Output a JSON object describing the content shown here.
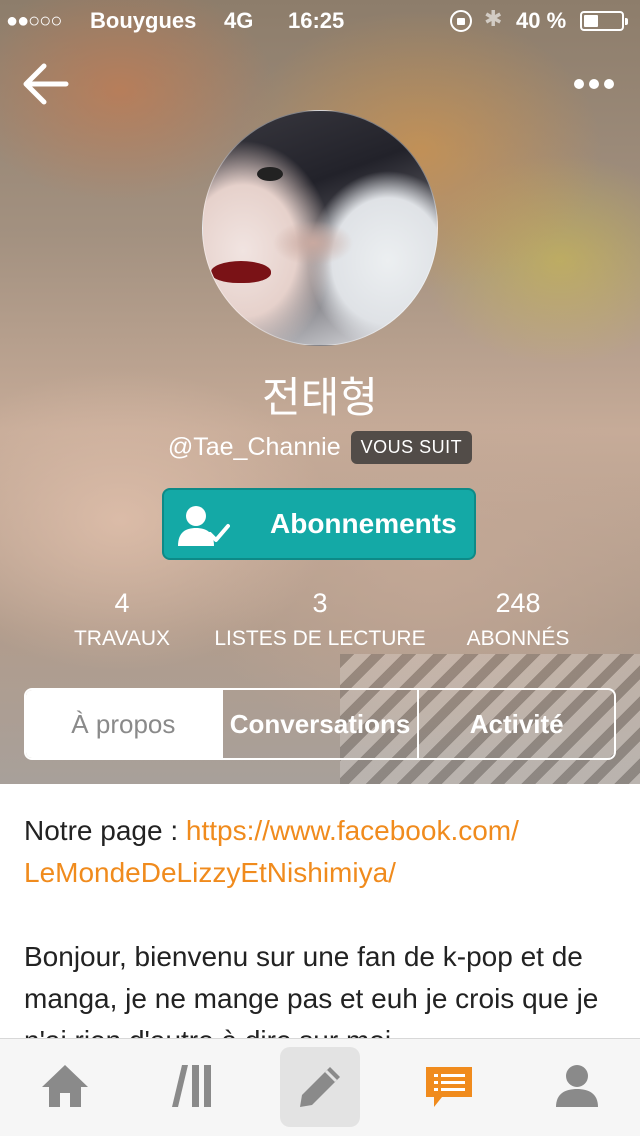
{
  "status_bar": {
    "signal": "●●○○○",
    "carrier": "Bouygues",
    "network": "4G",
    "time": "16:25",
    "bluetooth": "✱",
    "battery_pct": "40 %",
    "battery_level": 0.4
  },
  "profile": {
    "display_name": "전태형",
    "handle": "@Tae_Channie",
    "follows_you_badge": "VOUS SUIT",
    "follow_button_label": "Abonnements"
  },
  "stats": [
    {
      "value": "4",
      "label": "TRAVAUX"
    },
    {
      "value": "3",
      "label": "LISTES DE LECTURE"
    },
    {
      "value": "248",
      "label": "ABONNÉS"
    }
  ],
  "tabs": [
    {
      "label": "À propos",
      "active": true
    },
    {
      "label": "Conversations",
      "active": false
    },
    {
      "label": "Activité",
      "active": false
    }
  ],
  "about": {
    "page_prefix": "Notre page : ",
    "page_link": "https://www.facebook.com/ LeMondeDeLizzyEtNishimiya/",
    "bio": "Bonjour, bienvenu sur une fan de k-pop et de manga, je ne mange pas et euh je crois que je n'ai rien d'autre à dire sur moi."
  },
  "tab_bar": {
    "items": [
      {
        "icon": "home-icon"
      },
      {
        "icon": "library-icon"
      },
      {
        "icon": "write-icon"
      },
      {
        "icon": "messages-icon"
      },
      {
        "icon": "profile-icon"
      }
    ]
  },
  "colors": {
    "accent_teal": "#14a9a6",
    "link_orange": "#f08b1d",
    "active_tab_orange": "#f08b1d",
    "inactive_icon": "#8a8a8a"
  }
}
